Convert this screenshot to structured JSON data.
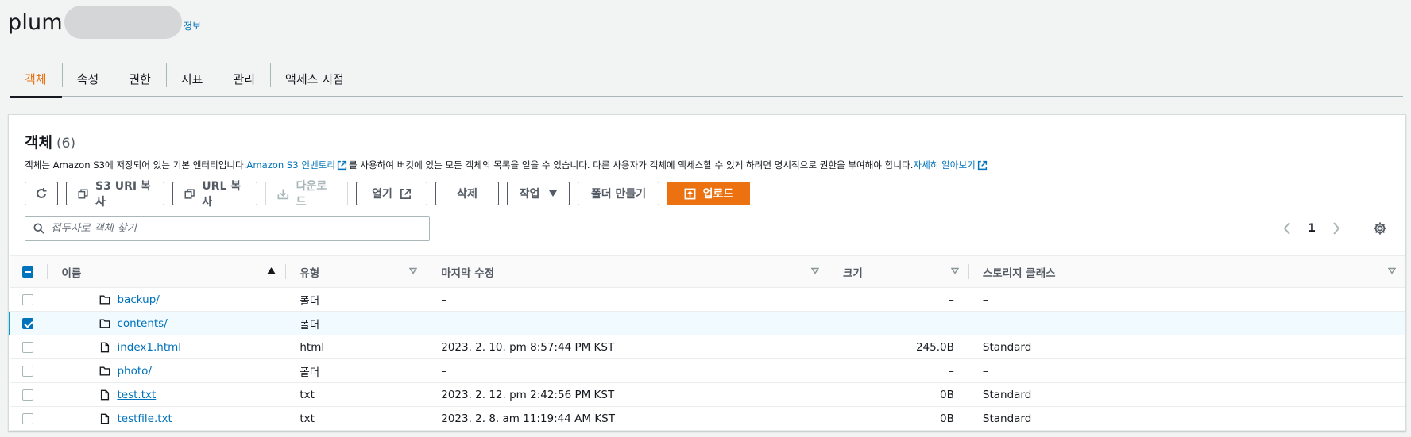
{
  "page": {
    "title_prefix": "plum",
    "info_link": "정보"
  },
  "tabs": [
    {
      "label": "객체",
      "active": true
    },
    {
      "label": "속성"
    },
    {
      "label": "권한"
    },
    {
      "label": "지표"
    },
    {
      "label": "관리"
    },
    {
      "label": "액세스 지점"
    }
  ],
  "objects": {
    "heading": "객체",
    "count": "(6)",
    "desc_part1": "객체는 Amazon S3에 저장되어 있는 기본 엔터티입니다. ",
    "desc_link1": "Amazon S3 인벤토리",
    "desc_part2": "를 사용하여 버킷에 있는 모든 객체의 목록을 얻을 수 있습니다. 다른 사용자가 객체에 액세스할 수 있게 하려면 명시적으로 권한을 부여해야 합니다. ",
    "desc_link2": "자세히 알아보기"
  },
  "toolbar": {
    "copy_s3_uri": "S3 URI 복사",
    "copy_url": "URL 복사",
    "download": "다운로드",
    "open": "열기",
    "delete": "삭제",
    "actions": "작업",
    "create_folder": "폴더 만들기",
    "upload": "업로드"
  },
  "search": {
    "placeholder": "접두사로 객체 찾기"
  },
  "pagination": {
    "page": "1"
  },
  "table": {
    "headers": {
      "name": "이름",
      "type": "유형",
      "modified": "마지막 수정",
      "size": "크기",
      "storage": "스토리지 클래스"
    },
    "rows": [
      {
        "name": "backup/",
        "kind": "folder",
        "type": "폴더",
        "modified": "–",
        "size": "–",
        "storage": "–",
        "selected": false
      },
      {
        "name": "contents/",
        "kind": "folder",
        "type": "폴더",
        "modified": "–",
        "size": "–",
        "storage": "–",
        "selected": true
      },
      {
        "name": "index1.html",
        "kind": "file",
        "type": "html",
        "modified": "2023. 2. 10. pm 8:57:44 PM KST",
        "size": "245.0B",
        "storage": "Standard",
        "selected": false
      },
      {
        "name": "photo/",
        "kind": "folder",
        "type": "폴더",
        "modified": "–",
        "size": "–",
        "storage": "–",
        "selected": false
      },
      {
        "name": "test.txt",
        "kind": "file",
        "type": "txt",
        "modified": "2023. 2. 12. pm 2:42:56 PM KST",
        "size": "0B",
        "storage": "Standard",
        "selected": false
      },
      {
        "name": "testfile.txt",
        "kind": "file",
        "type": "txt",
        "modified": "2023. 2. 8. am 11:19:44 AM KST",
        "size": "0B",
        "storage": "Standard",
        "selected": false
      }
    ]
  },
  "colors": {
    "accent": "#ec7211",
    "link": "#0073bb",
    "selection": "#0073bb"
  }
}
